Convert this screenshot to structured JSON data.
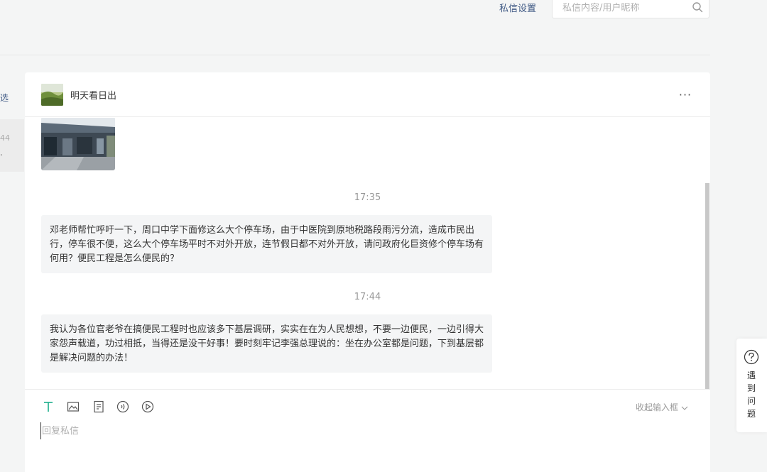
{
  "topbar": {
    "settings_label": "私信设置",
    "search_placeholder": "私信内容/用户昵称",
    "search_value": ""
  },
  "left_panel": {
    "filter_label": "选",
    "conv_time": "44",
    "conv_preview": "."
  },
  "chat": {
    "contact_name": "明天看日出",
    "more_icon": "···",
    "messages": [
      {
        "time": "17:35",
        "text": "邓老师帮忙呼吁一下，周口中学下面修这么大个停车场，由于中医院到原地税路段雨污分流，造成市民出行，停车很不便，这么大个停车场平时不对外开放，连节假日都不对外开放，请问政府化巨资修个停车场有何用？便民工程是怎么便民的？"
      },
      {
        "time": "17:44",
        "text": "我认为各位官老爷在搞便民工程时也应该多下基层调研，实实在在为人民想想，不要一边便民，一边引得大家怨声载道，功过相抵，当得还是没干好事！要时刻牢记李强总理说的：坐在办公室都是问题，下到基层都是解决问题的办法！"
      }
    ]
  },
  "input_area": {
    "tools": [
      "text-icon",
      "image-icon",
      "article-icon",
      "audio-icon",
      "video-icon"
    ],
    "collapse_label": "收起输入框",
    "reply_placeholder": "回复私信"
  },
  "help": {
    "label": "遇到问题"
  },
  "colors": {
    "accent_green": "#1aad8a",
    "link_blue": "#405a85"
  }
}
